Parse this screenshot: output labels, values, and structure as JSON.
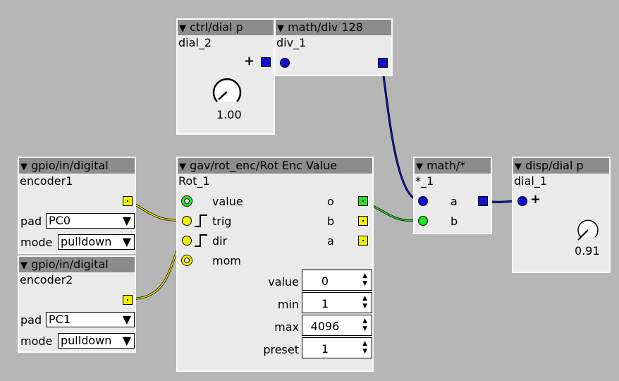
{
  "objects": {
    "ctrl_dial": {
      "header": "ctrl/dial p",
      "instance": "dial_2",
      "value": "1.00"
    },
    "math_div": {
      "header": "math/div 128",
      "instance": "div_1"
    },
    "enc1": {
      "header": "gpio/in/digital",
      "instance": "encoder1",
      "pad_label": "pad",
      "pad_value": "PC0",
      "mode_label": "mode",
      "mode_value": "pulldown"
    },
    "enc2": {
      "header": "gpio/in/digital",
      "instance": "encoder2",
      "pad_label": "pad",
      "pad_value": "PC1",
      "mode_label": "mode",
      "mode_value": "pulldown"
    },
    "rot": {
      "header": "gav/rot_enc/Rot Enc Value",
      "instance": "Rot_1",
      "inputs": [
        "value",
        "trig",
        "dir",
        "mom"
      ],
      "outputs": [
        "o",
        "b",
        "a"
      ],
      "params": [
        {
          "label": "value",
          "value": "0"
        },
        {
          "label": "min",
          "value": "1"
        },
        {
          "label": "max",
          "value": "4096"
        },
        {
          "label": "preset",
          "value": "1"
        }
      ]
    },
    "math_mul": {
      "header": "math/*",
      "instance": "*_1",
      "in_a": "a",
      "in_b": "b"
    },
    "disp_dial": {
      "header": "disp/dial p",
      "instance": "dial_1",
      "value": "0.91"
    }
  },
  "glyphs": {
    "collapse": "▼",
    "dropdown": "▼",
    "plus": "+",
    "spin": "▲▼"
  },
  "colors": {
    "canvas": "#b6b6b6",
    "header": "#8c8c8c",
    "body": "#eaeaea",
    "bool": "#f2f200",
    "frac": "#1010d0",
    "int": "#1ee61e"
  }
}
